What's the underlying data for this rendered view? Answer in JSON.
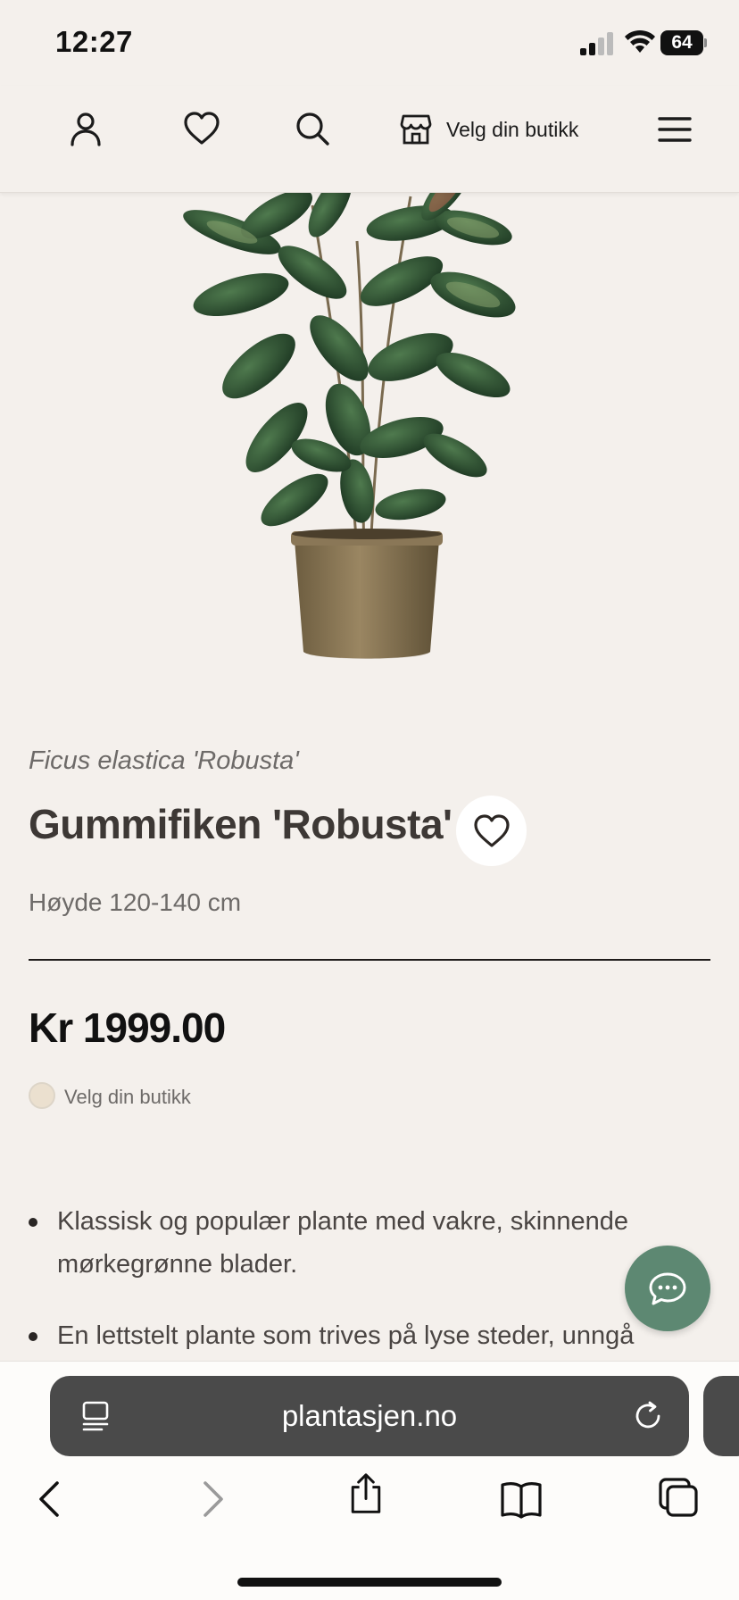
{
  "status_bar": {
    "time": "12:27",
    "battery": "64"
  },
  "nav": {
    "store_label": "Velg din butikk",
    "icons": [
      "user-icon",
      "heart-icon",
      "search-icon",
      "store-icon",
      "menu-icon"
    ]
  },
  "product": {
    "latin_name": "Ficus elastica 'Robusta'",
    "title": "Gummifiken 'Robusta'",
    "height": "Høyde 120-140 cm",
    "price": "Kr 1999.00",
    "store_select_label": "Velg din butikk",
    "description": [
      "Klassisk og populær plante med vakre, skinnende mørkegrønne blader.",
      "En lettstelt plante som trives på lyse steder, unngå"
    ]
  },
  "browser": {
    "url": "plantasjen.no"
  },
  "colors": {
    "background": "#f4f0ec",
    "chat_button": "#5d8872",
    "url_pill": "#4a4a4a"
  }
}
